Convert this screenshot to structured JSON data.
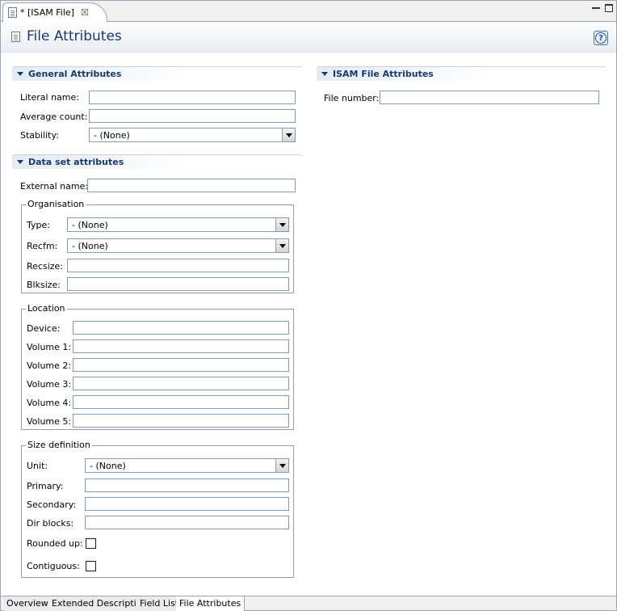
{
  "editor_tab": {
    "label": "* [ISAM File]",
    "close": "☒"
  },
  "header": {
    "title": "File Attributes",
    "help": "?"
  },
  "general": {
    "title": "General Attributes",
    "literal_name_label": "Literal name:",
    "average_count_label": "Average count:",
    "stability_label": "Stability:",
    "stability_value": "- (None)"
  },
  "dataset": {
    "title": "Data set attributes",
    "external_name_label": "External name:",
    "organisation": {
      "title": "Organisation",
      "type_label": "Type:",
      "type_value": "- (None)",
      "recfm_label": "Recfm:",
      "recfm_value": "- (None)",
      "recsize_label": "Recsize:",
      "blksize_label": "Blksize:"
    },
    "location": {
      "title": "Location",
      "device_label": "Device:",
      "volume1_label": "Volume 1:",
      "volume2_label": "Volume 2:",
      "volume3_label": "Volume 3:",
      "volume4_label": "Volume 4:",
      "volume5_label": "Volume 5:"
    },
    "size": {
      "title": "Size definition",
      "unit_label": "Unit:",
      "unit_value": "- (None)",
      "primary_label": "Primary:",
      "secondary_label": "Secondary:",
      "dir_blocks_label": "Dir blocks:",
      "rounded_up_label": "Rounded up:",
      "contiguous_label": "Contiguous:"
    }
  },
  "isam": {
    "title": "ISAM File Attributes",
    "file_number_label": "File number:"
  },
  "bottom_tabs": [
    "Overview",
    "Extended Description",
    "Field List",
    "File Attributes"
  ]
}
